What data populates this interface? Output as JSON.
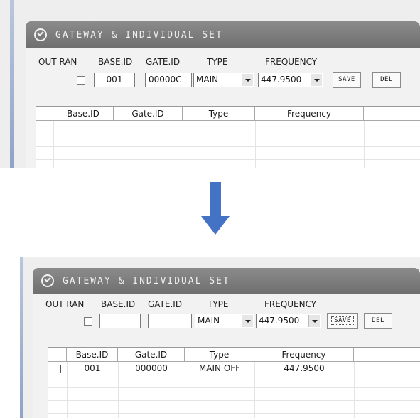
{
  "panel_title": "GATEWAY & INDIVIDUAL SET",
  "labels": {
    "out_ran": "OUT RAN",
    "base_id": "BASE.ID",
    "gate_id": "GATE.ID",
    "type": "TYPE",
    "frequency": "FREQUENCY"
  },
  "buttons": {
    "save": "SAVE",
    "del": "DEL"
  },
  "before": {
    "base_id_value": "001",
    "gate_id_value": "00000C",
    "type_value": "MAIN",
    "frequency_value": "447.9500"
  },
  "after": {
    "base_id_value": "",
    "gate_id_value": "",
    "type_value": "MAIN",
    "frequency_value": "447.9500"
  },
  "grid": {
    "columns": [
      "Base.ID",
      "Gate.ID",
      "Type",
      "Frequency"
    ],
    "rows": [
      {
        "base_id": "001",
        "gate_id": "000000",
        "type": "MAIN OFF",
        "frequency": "447.9500"
      }
    ]
  },
  "colors": {
    "arrow": "#4472c4",
    "header": "#7a7a7a",
    "accent": "#a9b8d4"
  },
  "icons": {
    "header": "check-circle-icon",
    "transition": "down-arrow-icon"
  }
}
